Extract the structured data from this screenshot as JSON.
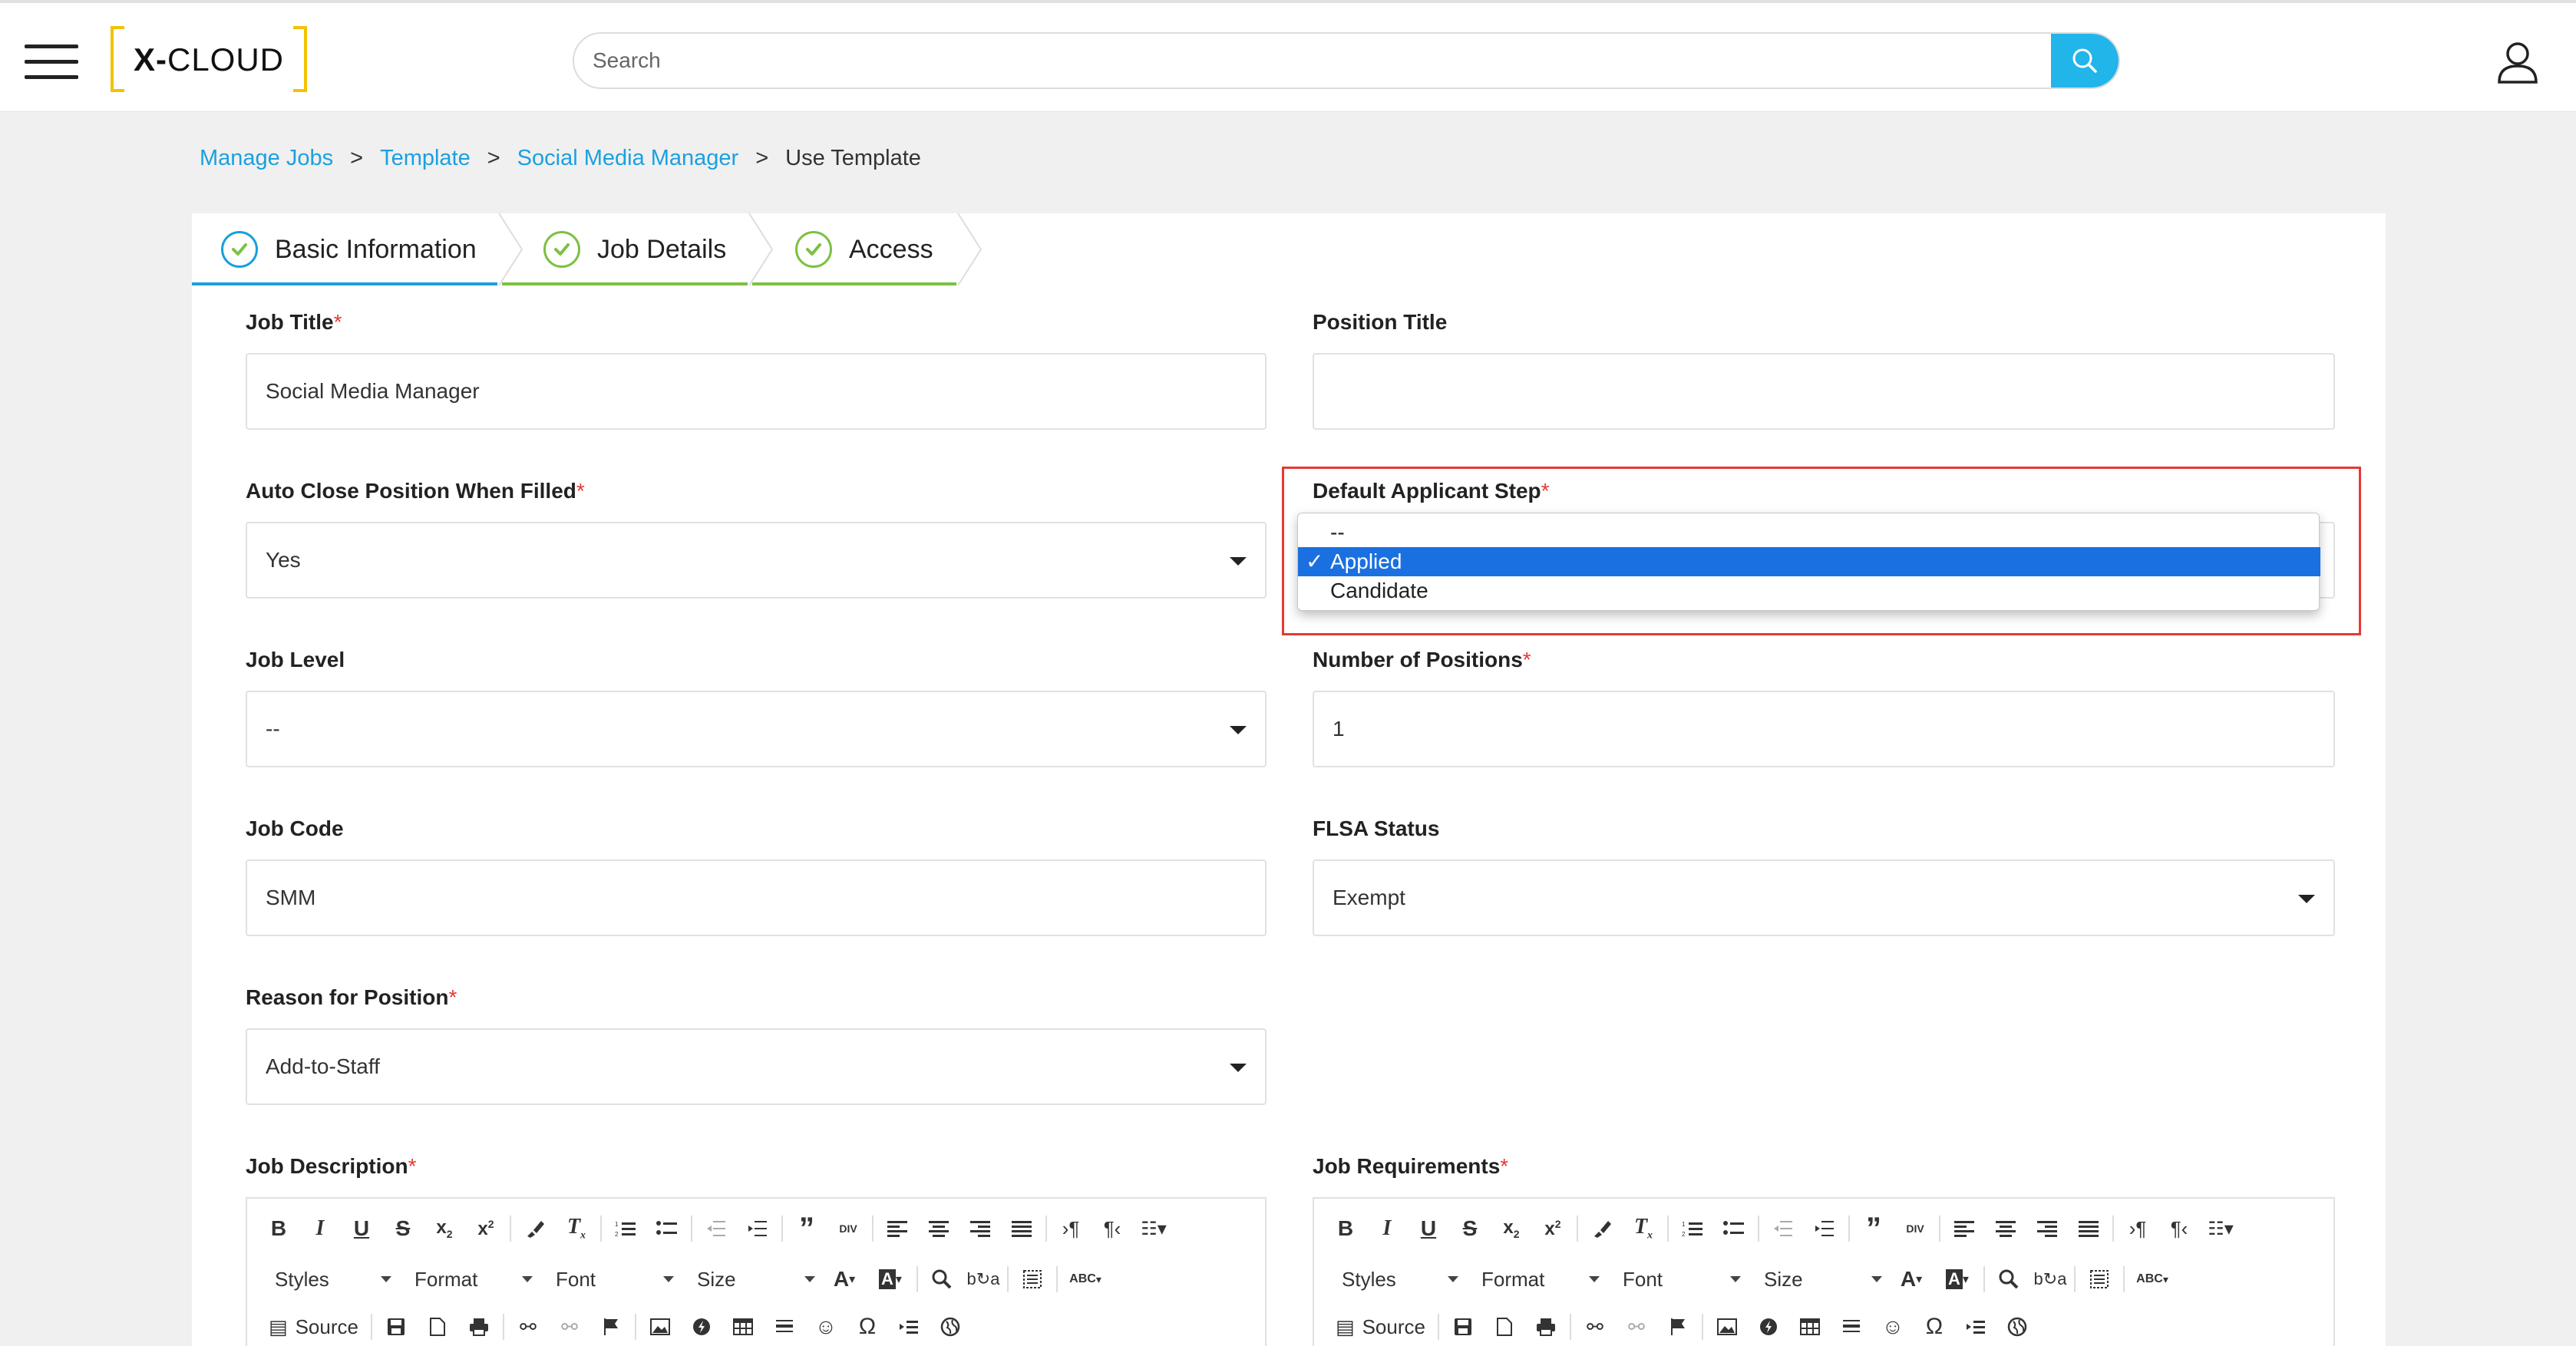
{
  "header": {
    "logo_bold": "X-",
    "logo_rest": "CLOUD",
    "search_placeholder": "Search"
  },
  "breadcrumb": {
    "items": [
      "Manage Jobs",
      "Template",
      "Social Media Manager"
    ],
    "current": "Use Template",
    "separator": ">"
  },
  "tabs": [
    {
      "label": "Basic Information",
      "accent": "#1a9fe0"
    },
    {
      "label": "Job Details",
      "accent": "#7cc142"
    },
    {
      "label": "Access",
      "accent": "#7cc142"
    }
  ],
  "form": {
    "job_title": {
      "label": "Job Title",
      "value": "Social Media Manager",
      "required": "*"
    },
    "position_title": {
      "label": "Position Title",
      "value": ""
    },
    "auto_close": {
      "label": "Auto Close Position When Filled",
      "value": "Yes",
      "required": "*"
    },
    "default_step": {
      "label": "Default Applicant Step",
      "required": "*",
      "options": [
        "--",
        "Applied",
        "Candidate"
      ],
      "selected": "Applied",
      "check": "✓"
    },
    "job_level": {
      "label": "Job Level",
      "value": "--"
    },
    "num_positions": {
      "label": "Number of Positions",
      "value": "1",
      "required": "*"
    },
    "job_code": {
      "label": "Job Code",
      "value": "SMM"
    },
    "flsa": {
      "label": "FLSA Status",
      "value": "Exempt"
    },
    "reason": {
      "label": "Reason for Position",
      "value": "Add-to-Staff",
      "required": "*"
    },
    "job_description": {
      "label": "Job Description",
      "required": "*"
    },
    "job_requirements": {
      "label": "Job Requirements",
      "required": "*"
    }
  },
  "editor_toolbar": {
    "row1": [
      "B",
      "I",
      "U",
      "S",
      "x₂",
      "x²",
      "paintbrush",
      "Tx",
      "ol",
      "ul",
      "outdent",
      "indent",
      "❞",
      "div",
      "align-left",
      "align-center",
      "align-right",
      "justify",
      "ltr",
      "rtl",
      "lang"
    ],
    "styles": "Styles",
    "format": "Format",
    "font": "Font",
    "size": "Size",
    "source": "Source"
  },
  "colors": {
    "accent_blue": "#22b5ea",
    "link_blue": "#1ba0e0",
    "required_red": "#e53935",
    "check_green": "#7cc142",
    "logo_yellow": "#f2c200",
    "select_blue": "#1a70e0"
  }
}
